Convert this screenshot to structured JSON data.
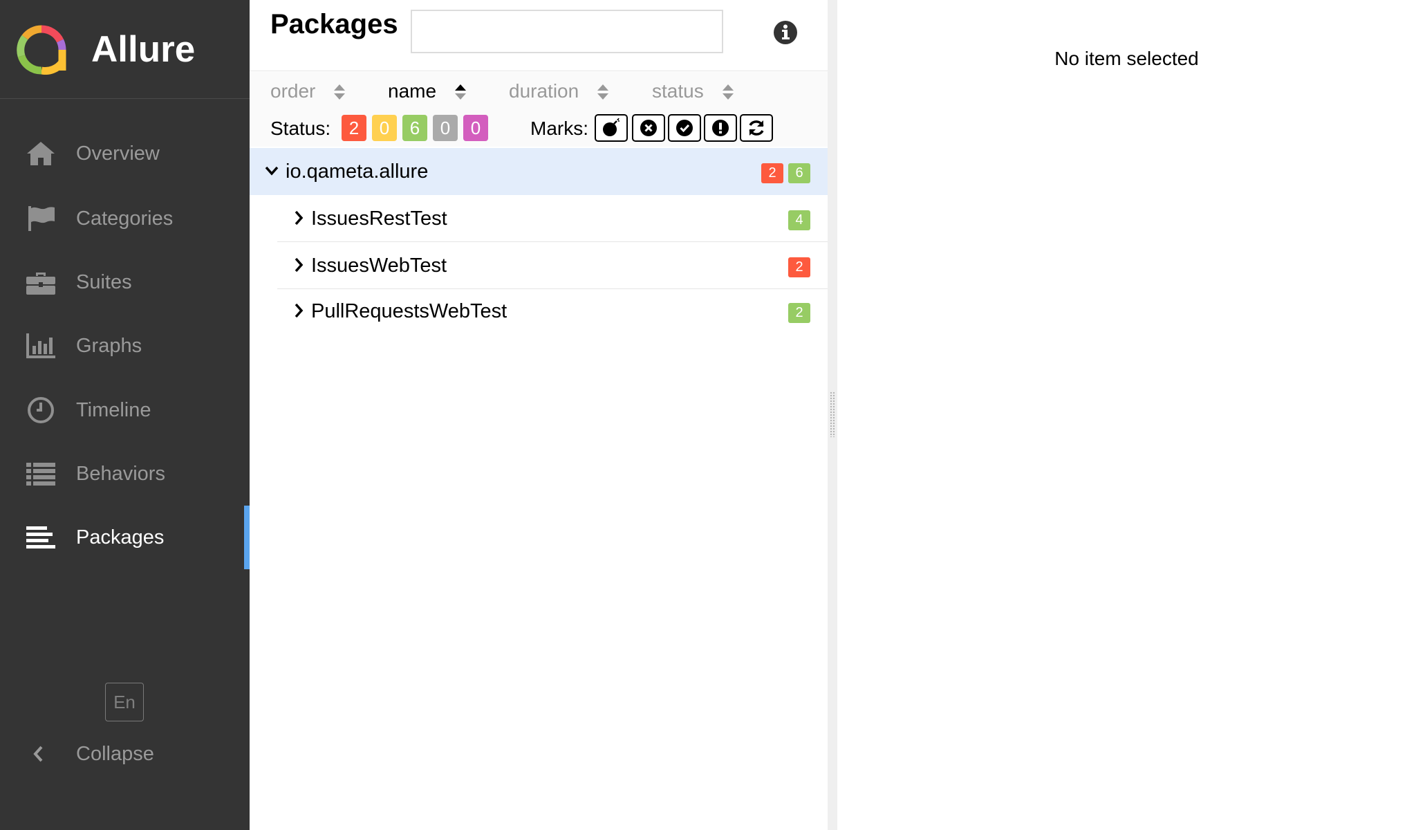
{
  "sidebar": {
    "brand_name": "Allure",
    "items": [
      {
        "label": "Overview",
        "icon": "home-icon",
        "active": false
      },
      {
        "label": "Categories",
        "icon": "flag-icon",
        "active": false
      },
      {
        "label": "Suites",
        "icon": "briefcase-icon",
        "active": false
      },
      {
        "label": "Graphs",
        "icon": "bar-chart-icon",
        "active": false
      },
      {
        "label": "Timeline",
        "icon": "clock-icon",
        "active": false
      },
      {
        "label": "Behaviors",
        "icon": "list-icon",
        "active": false
      },
      {
        "label": "Packages",
        "icon": "align-left-icon",
        "active": true
      }
    ],
    "language_label": "En",
    "collapse_label": "Collapse"
  },
  "tree": {
    "title": "Packages",
    "search": {
      "value": "",
      "placeholder": ""
    },
    "sort": [
      {
        "label": "order",
        "active": false
      },
      {
        "label": "name",
        "active": true
      },
      {
        "label": "duration",
        "active": false
      },
      {
        "label": "status",
        "active": false
      }
    ],
    "status_filter": {
      "label": "Status:",
      "items": [
        {
          "name": "failed",
          "count": "2",
          "color": "#fd5a3e"
        },
        {
          "name": "broken",
          "count": "0",
          "color": "#ffd050"
        },
        {
          "name": "passed",
          "count": "6",
          "color": "#97cc64"
        },
        {
          "name": "skipped",
          "count": "0",
          "color": "#aaaaaa"
        },
        {
          "name": "unknown",
          "count": "0",
          "color": "#d35ebe"
        }
      ]
    },
    "marks_filter": {
      "label": "Marks:",
      "items": [
        "bomb-icon",
        "times-circle-icon",
        "check-circle-icon",
        "exclamation-circle-icon",
        "refresh-icon"
      ]
    },
    "rows": [
      {
        "label": "io.qameta.allure",
        "kind": "group",
        "expanded": true,
        "counts": [
          {
            "value": "2",
            "color": "#fd5a3e"
          },
          {
            "value": "6",
            "color": "#97cc64"
          }
        ]
      },
      {
        "label": "IssuesRestTest",
        "kind": "child",
        "expanded": false,
        "counts": [
          {
            "value": "4",
            "color": "#97cc64"
          }
        ]
      },
      {
        "label": "IssuesWebTest",
        "kind": "child",
        "expanded": false,
        "counts": [
          {
            "value": "2",
            "color": "#fd5a3e"
          }
        ]
      },
      {
        "label": "PullRequestsWebTest",
        "kind": "child",
        "expanded": false,
        "counts": [
          {
            "value": "2",
            "color": "#97cc64"
          }
        ]
      }
    ]
  },
  "detail": {
    "empty_message": "No item selected"
  }
}
